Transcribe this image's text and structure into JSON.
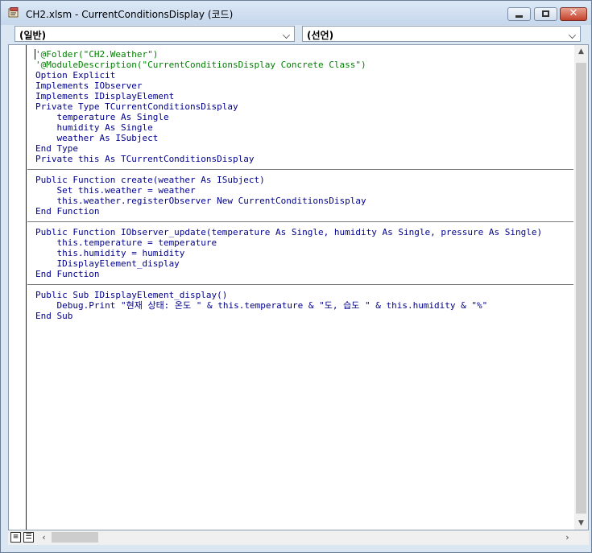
{
  "window": {
    "title": "CH2.xlsm - CurrentConditionsDisplay (코드)"
  },
  "combos": {
    "object": "(일반)",
    "procedure": "(선언)"
  },
  "code": [
    {
      "text": "'@Folder(\"CH2.Weather\")",
      "type": "comment"
    },
    {
      "text": "'@ModuleDescription(\"CurrentConditionsDisplay Concrete Class\")",
      "type": "comment"
    },
    {
      "text": "Option Explicit",
      "type": "code"
    },
    {
      "text": "Implements IObserver",
      "type": "code"
    },
    {
      "text": "Implements IDisplayElement",
      "type": "code"
    },
    {
      "text": "Private Type TCurrentConditionsDisplay",
      "type": "code"
    },
    {
      "text": "    temperature As Single",
      "type": "code"
    },
    {
      "text": "    humidity As Single",
      "type": "code"
    },
    {
      "text": "    weather As ISubject",
      "type": "code"
    },
    {
      "text": "End Type",
      "type": "code"
    },
    {
      "text": "Private this As TCurrentConditionsDisplay",
      "type": "code"
    },
    {
      "text": "",
      "type": "separator"
    },
    {
      "text": "Public Function create(weather As ISubject)",
      "type": "code"
    },
    {
      "text": "    Set this.weather = weather",
      "type": "code"
    },
    {
      "text": "    this.weather.registerObserver New CurrentConditionsDisplay",
      "type": "code"
    },
    {
      "text": "End Function",
      "type": "code"
    },
    {
      "text": "",
      "type": "separator"
    },
    {
      "text": "Public Function IObserver_update(temperature As Single, humidity As Single, pressure As Single)",
      "type": "code"
    },
    {
      "text": "    this.temperature = temperature",
      "type": "code"
    },
    {
      "text": "    this.humidity = humidity",
      "type": "code"
    },
    {
      "text": "    IDisplayElement_display",
      "type": "code"
    },
    {
      "text": "End Function",
      "type": "code"
    },
    {
      "text": "",
      "type": "separator"
    },
    {
      "text": "Public Sub IDisplayElement_display()",
      "type": "code"
    },
    {
      "text": "    Debug.Print \"현재 상태: 온도 \" & this.temperature & \"도, 습도 \" & this.humidity & \"%\"",
      "type": "code"
    },
    {
      "text": "End Sub",
      "type": "code"
    }
  ],
  "icons": {
    "app": "vba-module-icon",
    "minimize": "minimize-icon",
    "maximize": "maximize-icon",
    "close": "close-icon",
    "dropdown": "chevron-down-icon",
    "scroll_up": "chevron-up-icon",
    "scroll_down": "chevron-down-icon",
    "scroll_left": "chevron-left-icon",
    "scroll_right": "chevron-right-icon",
    "procedure_view": "procedure-view-icon",
    "full_module_view": "full-module-view-icon"
  },
  "colors": {
    "keyword": "#00008b",
    "comment": "#008000",
    "title_bar": "#d2e0f2",
    "close_button": "#c8472f"
  }
}
